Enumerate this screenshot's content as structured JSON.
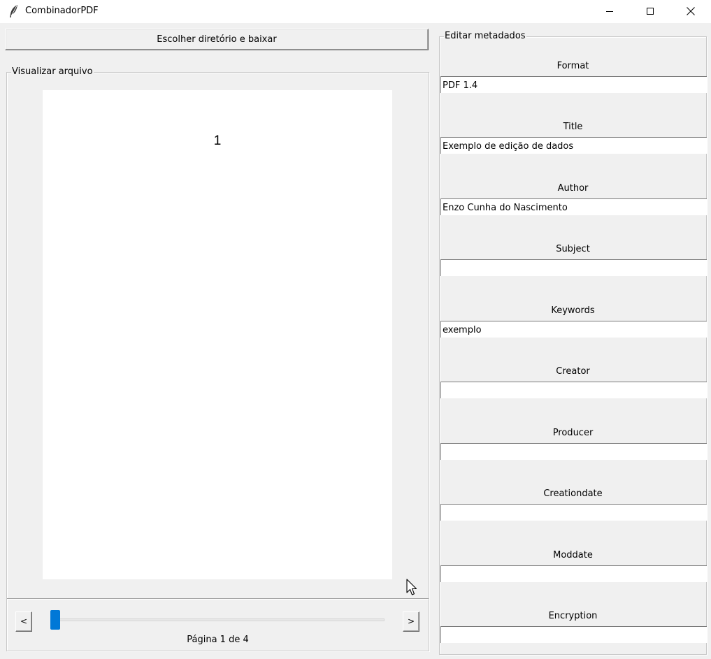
{
  "window": {
    "title": "CombinadorPDF",
    "icon": "feather-icon"
  },
  "toolbar": {
    "download_label": "Escolher diretório e baixar"
  },
  "viewer": {
    "legend": "Visualizar arquivo",
    "page_content": "1",
    "prev_label": "<",
    "next_label": ">",
    "status": "Página 1 de 4",
    "current_page": 1,
    "total_pages": 4
  },
  "metadata": {
    "legend": "Editar metadados",
    "fields": [
      {
        "label": "Format",
        "value": "PDF 1.4"
      },
      {
        "label": "Title",
        "value": "Exemplo de edição de dados"
      },
      {
        "label": "Author",
        "value": "Enzo Cunha do Nascimento"
      },
      {
        "label": "Subject",
        "value": ""
      },
      {
        "label": "Keywords",
        "value": "exemplo"
      },
      {
        "label": "Creator",
        "value": ""
      },
      {
        "label": "Producer",
        "value": ""
      },
      {
        "label": "Creationdate",
        "value": ""
      },
      {
        "label": "Moddate",
        "value": ""
      },
      {
        "label": "Encryption",
        "value": ""
      }
    ]
  },
  "colors": {
    "background": "#f0f0f0",
    "slider_accent": "#0078d7",
    "page": "#ffffff"
  }
}
